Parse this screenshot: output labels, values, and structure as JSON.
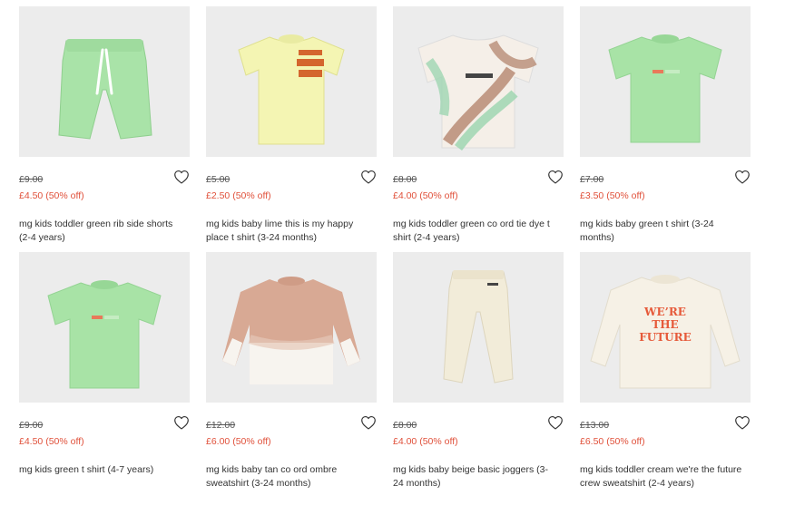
{
  "products": [
    {
      "original_price": "£9.00",
      "sale_price": "£4.50 (50% off)",
      "title": "mg kids toddler green rib side shorts (2-4 years)",
      "illustration": "green-shorts",
      "garment_color": "#a9e3a8",
      "accent_color": "#ffffff"
    },
    {
      "original_price": "£5.00",
      "sale_price": "£2.50 (50% off)",
      "title": "mg kids baby lime this is my happy place t shirt (3-24 months)",
      "illustration": "lime-tshirt",
      "garment_color": "#f4f5b3",
      "accent_color": "#d4662e"
    },
    {
      "original_price": "£8.00",
      "sale_price": "£4.00 (50% off)",
      "title": "mg kids toddler green co ord tie dye t shirt (2-4 years)",
      "illustration": "tie-dye-tshirt",
      "garment_color": "#f5efe8",
      "accent_color": "#b88c76"
    },
    {
      "original_price": "£7.00",
      "sale_price": "£3.50 (50% off)",
      "title": "mg kids baby green t shirt (3-24 months)",
      "illustration": "green-tshirt",
      "garment_color": "#a8e3a6",
      "accent_color": "#e8795a"
    },
    {
      "original_price": "£9.00",
      "sale_price": "£4.50 (50% off)",
      "title": "mg kids green t shirt (4-7 years)",
      "illustration": "green-tshirt",
      "garment_color": "#a8e3a6",
      "accent_color": "#e8795a"
    },
    {
      "original_price": "£12.00",
      "sale_price": "£6.00 (50% off)",
      "title": "mg kids baby tan co ord ombre sweatshirt (3-24 months)",
      "illustration": "tan-ombre-sweatshirt",
      "garment_color": "#d8a994",
      "accent_color": "#f7f4ef"
    },
    {
      "original_price": "£8.00",
      "sale_price": "£4.00 (50% off)",
      "title": "mg kids baby beige basic joggers (3-24 months)",
      "illustration": "beige-joggers",
      "garment_color": "#f2ecd9",
      "accent_color": "#444444"
    },
    {
      "original_price": "£13.00",
      "sale_price": "£6.50 (50% off)",
      "title": "mg kids toddler cream we're the future crew sweatshirt (2-4 years)",
      "illustration": "cream-sweatshirt",
      "garment_color": "#f6f1e6",
      "accent_color": "#e65a3a",
      "print_text": "WE'RE THE FUTURE"
    }
  ],
  "colors": {
    "image_bg": "#ececec",
    "sale": "#e0503a",
    "text": "#333333"
  },
  "icons": {
    "wishlist": "heart-outline-icon"
  }
}
